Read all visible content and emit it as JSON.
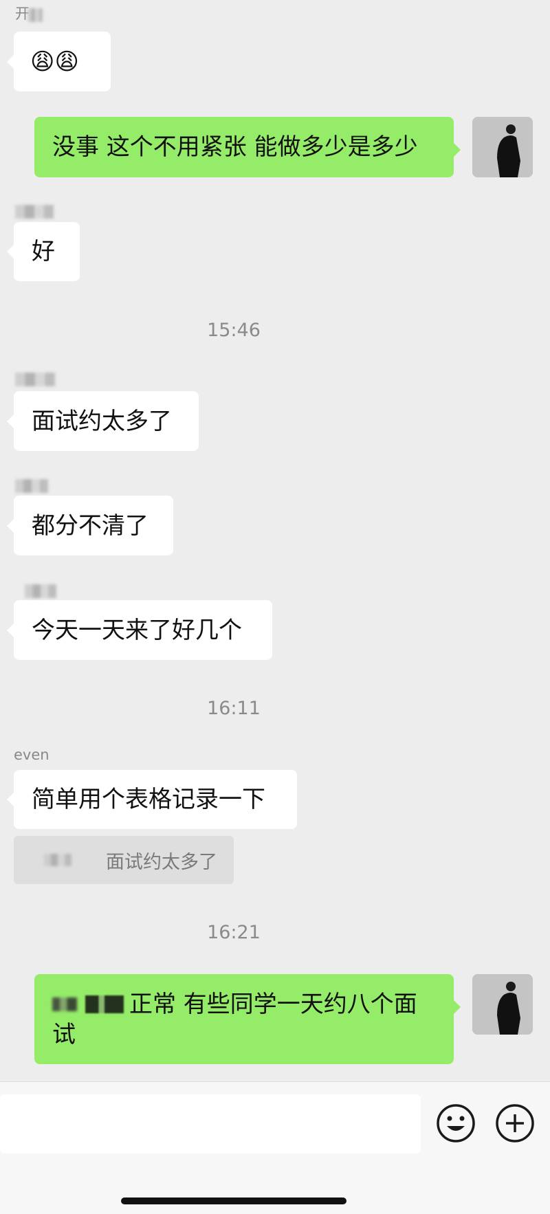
{
  "messages": [
    {
      "sender": "开",
      "content": "😩😩"
    },
    {
      "content": "没事 这个不用紧张 能做多少是多少"
    },
    {
      "content": "好"
    },
    {
      "content": "面试约太多了"
    },
    {
      "content": "都分不清了"
    },
    {
      "content": "今天一天来了好几个"
    },
    {
      "sender": "even",
      "content": "简单用个表格记录一下",
      "quote": "面试约太多了"
    },
    {
      "content": "正常 有些同学一天约八个面",
      "content_cont": "试"
    }
  ],
  "timestamps": [
    "15:46",
    "16:11",
    "16:21"
  ],
  "colors": {
    "background": "#ededed",
    "bubble_in": "#ffffff",
    "bubble_out": "#95ec69",
    "input_bar": "#f7f7f7"
  },
  "icons": {
    "emoji": "smiley-icon",
    "add": "plus-circle-icon"
  }
}
